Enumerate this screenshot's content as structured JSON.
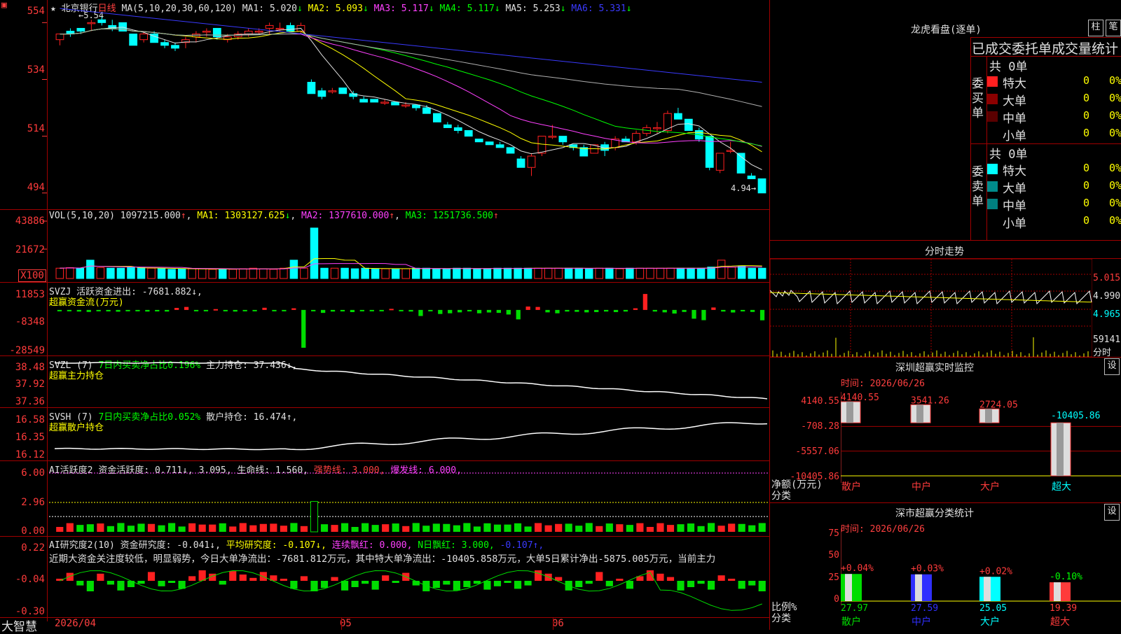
{
  "app": {
    "brand": "大智慧"
  },
  "stock": {
    "name": "北京银行",
    "period": "日线"
  },
  "colors": {
    "up": "#ff2020",
    "down": "#00ffff",
    "axis_red": "#ff3b3b",
    "ma1": "#e0e0e0",
    "ma2": "#ffff00",
    "ma3": "#ff40ff",
    "ma4": "#00ff00",
    "ma5": "#b0b0b0",
    "ma6": "#3a3aff"
  },
  "price_panel": {
    "ma_label": "MA(5,10,20,30,60,120)",
    "ma": [
      {
        "label": "MA1: 5.020",
        "arrow": "↓"
      },
      {
        "label": "MA2: 5.093",
        "arrow": "↓"
      },
      {
        "label": "MA3: 5.117",
        "arrow": "↓"
      },
      {
        "label": "MA4: 5.117",
        "arrow": "↓"
      },
      {
        "label": "MA5: 5.253",
        "arrow": "↓"
      },
      {
        "label": "MA6: 5.331",
        "arrow": "↓"
      }
    ],
    "high_mark": "5.54",
    "low_mark": "4.94",
    "y_ticks": [
      "554",
      "534",
      "514",
      "494"
    ],
    "corner_top": "▣",
    "corner_star": "★"
  },
  "vol_panel": {
    "label": "VOL(5,10,20)",
    "value": "1097215.000",
    "ma": [
      {
        "label": "MA1: 1303127.625",
        "arrow": "↓"
      },
      {
        "label": "MA2: 1377610.000",
        "arrow": "↑"
      },
      {
        "label": "MA3: 1251736.500",
        "arrow": "↑"
      }
    ],
    "y_ticks": [
      "43886",
      "21672",
      "X100"
    ]
  },
  "svzj_panel": {
    "line1": "SVZJ  活跃资金进出: -7681.882↓,",
    "line2": "超赢资金流(万元)",
    "y_ticks": [
      "11853",
      "-8348",
      "-28549"
    ]
  },
  "svzl_panel": {
    "name": "SVZL (7)",
    "ratio": "7日内买卖净占比0.196%",
    "holding": "主力持仓: 37.436↓,",
    "line2": "超赢主力持仓",
    "y_ticks": [
      "38.48",
      "37.92",
      "37.36"
    ]
  },
  "svsh_panel": {
    "name": "SVSH (7)",
    "ratio": "7日内买卖净占比0.052%",
    "holding": "散户持仓: 16.474↑,",
    "line2": "超赢散户持仓",
    "y_ticks": [
      "16.58",
      "16.35",
      "16.12"
    ]
  },
  "ai_active_panel": {
    "name": "AI活跃度2",
    "a": "资金活跃度: 0.711↓, 3.095,",
    "b": "生命线: 1.560,",
    "c": "强势线: 3.000,",
    "d": "爆发线: 6.000,",
    "y_ticks": [
      "6.00",
      "2.96",
      "0.00"
    ]
  },
  "ai_research_panel": {
    "name": "AI研究度2(10)",
    "a": "资金研究度: -0.041↓,",
    "b": "平均研究度: -0.107↓,",
    "c": "连续飘红: 0.000,",
    "d": "N日飘红: 3.000,",
    "e": "-0.107↑,",
    "comment": "近期大资金关注度较低，明显弱势，今日大单净流出：-7681.812万元，其中特大单净流出：-10405.858万元，大单5日累计净出-5875.005万元，当前主力",
    "y_ticks": [
      "0.22",
      "-0.04",
      "-0.30"
    ]
  },
  "x_axis": {
    "labels": [
      "2026/04",
      "05",
      "06"
    ]
  },
  "longhu": {
    "title": "龙虎看盘(逐单)",
    "btn_bar": "柱",
    "btn_detail": "笔",
    "header": "已成交委托单成交量统计",
    "buy": {
      "side": "委买单",
      "total": "共 0单",
      "rows": [
        {
          "name": "特大",
          "n": "0",
          "p": "0%"
        },
        {
          "name": "大单",
          "n": "0",
          "p": "0%"
        },
        {
          "name": "中单",
          "n": "0",
          "p": "0%"
        },
        {
          "name": "小单",
          "n": "0",
          "p": "0%"
        }
      ]
    },
    "sell": {
      "side": "委卖单",
      "total": "共 0单",
      "rows": [
        {
          "name": "特大",
          "n": "0",
          "p": "0%"
        },
        {
          "name": "大单",
          "n": "0",
          "p": "0%"
        },
        {
          "name": "中单",
          "n": "0",
          "p": "0%"
        },
        {
          "name": "小单",
          "n": "0",
          "p": "0%"
        }
      ]
    }
  },
  "intraday": {
    "title": "分时走势",
    "y_ticks": [
      "5.015",
      "4.990",
      "4.965"
    ],
    "vol_label": "59141",
    "sub_label": "分时"
  },
  "sz_monitor": {
    "title": "深圳超赢实时监控",
    "btn": "设",
    "time": "时间: 2026/06/26",
    "y_ticks": [
      "4140.55",
      "-708.28",
      "-5557.06",
      "-10405.86"
    ],
    "unit": "净额(万元)",
    "cat_label": "分类"
  },
  "sz_class": {
    "title": "深市超赢分类统计",
    "btn": "设",
    "time": "时间: 2026/06/26",
    "y_ticks": [
      "75",
      "50",
      "25",
      "0"
    ],
    "unit": "比例%",
    "cat_label": "分类"
  },
  "chart_data": [
    {
      "type": "candlestick",
      "title": "北京银行 日线",
      "ylim": [
        4.9,
        5.6
      ],
      "note": "approximate daily OHLC read from chart, left to right",
      "ohlc": [
        [
          5.48,
          5.5,
          5.46,
          5.5
        ],
        [
          5.51,
          5.52,
          5.49,
          5.5
        ],
        [
          5.52,
          5.52,
          5.5,
          5.51
        ],
        [
          5.54,
          5.55,
          5.51,
          5.54
        ],
        [
          5.55,
          5.56,
          5.53,
          5.54
        ],
        [
          5.53,
          5.55,
          5.51,
          5.52
        ],
        [
          5.54,
          5.54,
          5.51,
          5.51
        ],
        [
          5.5,
          5.5,
          5.46,
          5.46
        ],
        [
          5.48,
          5.51,
          5.47,
          5.5
        ],
        [
          5.5,
          5.51,
          5.47,
          5.47
        ],
        [
          5.47,
          5.48,
          5.45,
          5.46
        ],
        [
          5.46,
          5.47,
          5.44,
          5.45
        ],
        [
          5.47,
          5.49,
          5.45,
          5.48
        ],
        [
          5.49,
          5.51,
          5.47,
          5.5
        ],
        [
          5.51,
          5.52,
          5.49,
          5.51
        ],
        [
          5.52,
          5.52,
          5.48,
          5.49
        ],
        [
          5.48,
          5.5,
          5.47,
          5.49
        ],
        [
          5.49,
          5.51,
          5.48,
          5.5
        ],
        [
          5.5,
          5.52,
          5.49,
          5.51
        ],
        [
          5.51,
          5.52,
          5.5,
          5.51
        ],
        [
          5.52,
          5.54,
          5.5,
          5.53
        ],
        [
          5.52,
          5.54,
          5.51,
          5.52
        ],
        [
          5.53,
          5.54,
          5.51,
          5.51
        ],
        [
          5.51,
          5.54,
          5.5,
          5.53
        ],
        [
          5.33,
          5.34,
          5.29,
          5.29
        ],
        [
          5.3,
          5.31,
          5.27,
          5.28
        ],
        [
          5.3,
          5.31,
          5.29,
          5.3
        ],
        [
          5.31,
          5.31,
          5.29,
          5.29
        ],
        [
          5.29,
          5.3,
          5.27,
          5.28
        ],
        [
          5.27,
          5.28,
          5.26,
          5.26
        ],
        [
          5.27,
          5.27,
          5.26,
          5.26
        ],
        [
          5.26,
          5.27,
          5.25,
          5.26
        ],
        [
          5.26,
          5.26,
          5.25,
          5.25
        ],
        [
          5.25,
          5.26,
          5.24,
          5.25
        ],
        [
          5.25,
          5.25,
          5.23,
          5.24
        ],
        [
          5.24,
          5.25,
          5.22,
          5.22
        ],
        [
          5.22,
          5.22,
          5.19,
          5.19
        ],
        [
          5.18,
          5.19,
          5.17,
          5.17
        ],
        [
          5.17,
          5.18,
          5.15,
          5.16
        ],
        [
          5.16,
          5.16,
          5.14,
          5.14
        ],
        [
          5.13,
          5.13,
          5.12,
          5.12
        ],
        [
          5.12,
          5.12,
          5.11,
          5.11
        ],
        [
          5.11,
          5.12,
          5.1,
          5.1
        ],
        [
          5.1,
          5.1,
          5.08,
          5.08
        ],
        [
          5.06,
          5.07,
          5.03,
          5.03
        ],
        [
          5.03,
          5.08,
          5.0,
          5.07
        ],
        [
          5.08,
          5.14,
          5.07,
          5.14
        ],
        [
          5.14,
          5.18,
          5.13,
          5.14
        ],
        [
          5.14,
          5.14,
          5.11,
          5.12
        ],
        [
          5.11,
          5.11,
          5.09,
          5.1
        ],
        [
          5.1,
          5.11,
          5.07,
          5.07
        ],
        [
          5.08,
          5.11,
          5.08,
          5.11
        ],
        [
          5.11,
          5.12,
          5.07,
          5.09
        ],
        [
          5.1,
          5.14,
          5.09,
          5.13
        ],
        [
          5.13,
          5.14,
          5.12,
          5.12
        ],
        [
          5.12,
          5.16,
          5.11,
          5.15
        ],
        [
          5.15,
          5.18,
          5.14,
          5.17
        ],
        [
          5.17,
          5.19,
          5.15,
          5.17
        ],
        [
          5.16,
          5.23,
          5.15,
          5.22
        ],
        [
          5.22,
          5.24,
          5.2,
          5.2
        ],
        [
          5.2,
          5.2,
          5.16,
          5.16
        ],
        [
          5.16,
          5.17,
          5.12,
          5.13
        ],
        [
          5.14,
          5.14,
          5.02,
          5.03
        ],
        [
          5.02,
          5.08,
          5.01,
          5.08
        ],
        [
          5.09,
          5.12,
          5.08,
          5.09
        ],
        [
          5.08,
          5.08,
          5.01,
          5.01
        ],
        [
          5.0,
          5.01,
          4.99,
          4.99
        ],
        [
          4.99,
          4.99,
          4.94,
          4.94
        ]
      ]
    },
    {
      "type": "bar",
      "title": "VOL(5,10,20)",
      "unit": "X100",
      "ylim": [
        0,
        50000
      ],
      "values": [
        9000,
        9500,
        9000,
        16000,
        9500,
        9000,
        9000,
        9500,
        9500,
        9000,
        8500,
        8000,
        8500,
        8500,
        8500,
        8000,
        8000,
        8000,
        8500,
        9000,
        8500,
        8000,
        9000,
        16000,
        9000,
        44000,
        9000,
        9000,
        9000,
        8500,
        9000,
        8500,
        8500,
        8500,
        8500,
        9000,
        9000,
        8500,
        8500,
        9000,
        9000,
        8500,
        8500,
        9000,
        9000,
        9000,
        9000,
        9000,
        9000,
        9000,
        9000,
        9000,
        8500,
        9000,
        9000,
        8500,
        9000,
        9000,
        9000,
        9000,
        9000,
        9000,
        9000,
        9000,
        10000,
        16000,
        10000,
        11000,
        9000,
        9000
      ]
    },
    {
      "type": "bar",
      "title": "SVZJ 活跃资金进出",
      "unit": "万元",
      "ylim": [
        -28549,
        11853
      ],
      "values": [
        -800,
        -800,
        -1200,
        -1500,
        -900,
        -1100,
        -1300,
        -700,
        -800,
        -1200,
        -1100,
        -1200,
        1500,
        2200,
        -900,
        -600,
        600,
        -500,
        -1200,
        -800,
        -600,
        1600,
        -800,
        -700,
        1200,
        -28000,
        -1000,
        -2200,
        -1200,
        -1100,
        -1600,
        -700,
        -800,
        -600,
        800,
        -900,
        -1200,
        -4500,
        -600,
        -3000,
        -2500,
        -1800,
        -1100,
        -2500,
        -1900,
        -2200,
        -3400,
        -7000,
        2500,
        2200,
        -1800,
        -2500,
        -1200,
        -1400,
        -1800,
        -1600,
        -1200,
        -1600,
        -1200,
        1200,
        11800,
        -1200,
        -1800,
        -2700,
        -1500,
        -6500,
        -7600,
        1800,
        -1200,
        -1900,
        -1100,
        -1500,
        -7681
      ]
    },
    {
      "type": "line",
      "title": "SVZL 主力持仓",
      "ylim": [
        37.36,
        38.48
      ],
      "start": 38.48,
      "end": 37.436
    },
    {
      "type": "line",
      "title": "SVSH 散户持仓",
      "ylim": [
        16.12,
        16.58
      ],
      "start": 16.18,
      "end": 16.474
    },
    {
      "type": "bar",
      "title": "AI活跃度2",
      "ylim": [
        0,
        6.0
      ],
      "lines": {
        "生命线": 1.56,
        "强势线": 3.0,
        "爆发线": 6.0
      }
    },
    {
      "type": "bar",
      "title": "AI研究度2(10)",
      "ylim": [
        -0.3,
        0.22
      ]
    },
    {
      "type": "bar",
      "title": "深圳超赢实时监控",
      "categories": [
        "散户",
        "中户",
        "大户",
        "超大"
      ],
      "values": [
        4140.55,
        3541.26,
        2724.05,
        -10405.86
      ],
      "ylim": [
        -10405.86,
        4140.55
      ]
    },
    {
      "type": "bar",
      "title": "深市超赢分类统计",
      "categories": [
        "散户",
        "中户",
        "大户",
        "超大"
      ],
      "values": [
        27.97,
        27.59,
        25.05,
        19.39
      ],
      "changes": [
        "+0.04%",
        "+0.03%",
        "+0.02%",
        "-0.10%"
      ],
      "ylim": [
        0,
        75
      ]
    }
  ]
}
